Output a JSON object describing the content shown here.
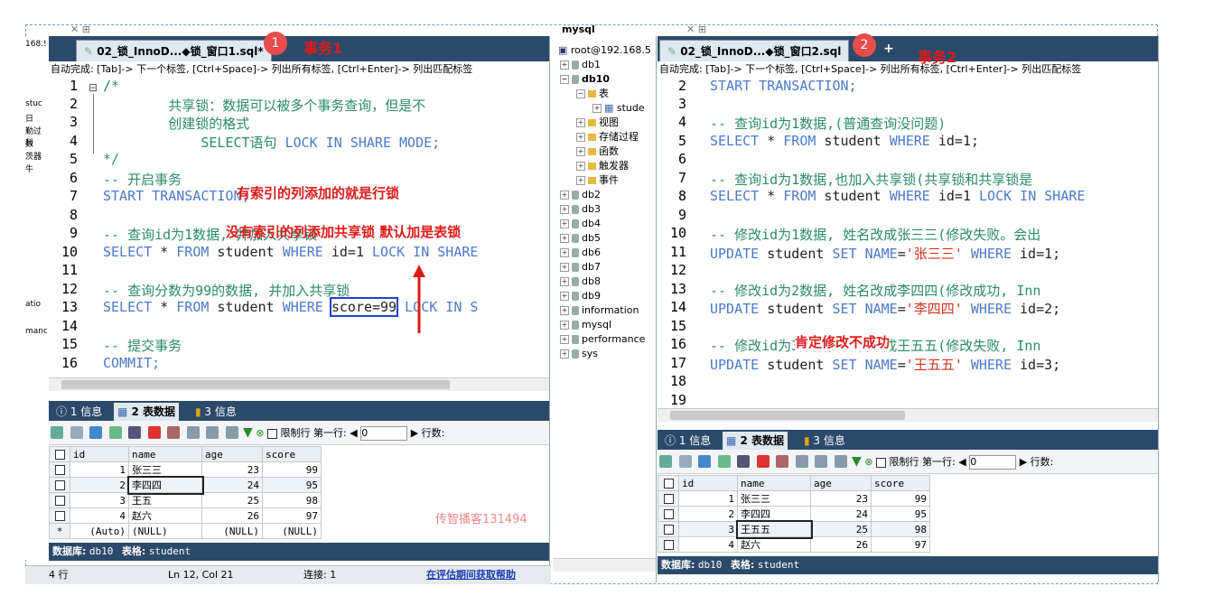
{
  "top_label": "mysql",
  "left_strip": [
    "168.!",
    "stuc",
    "日",
    "勤过科",
    "数",
    "茨器",
    "牛",
    "atio",
    "manc"
  ],
  "editor1": {
    "tab_title": "02_锁_InnoD...◆锁_窗口1.sql*",
    "badge": "1",
    "annotation_title": "事务1",
    "hint": "自动完成: [Tab]-> 下一个标签, [Ctrl+Space]-> 列出所有标签, [Ctrl+Enter]-> 列出匹配标签",
    "line_numbers": [
      "1",
      "2",
      "3",
      "4",
      "5",
      "6",
      "7",
      "8",
      "9",
      "10",
      "11",
      "12",
      "13",
      "14",
      "15",
      "16"
    ],
    "lines": {
      "l1": "/*",
      "l2": "        共享锁：数据可以被多个事务查询，但是不",
      "l3": "        创建锁的格式",
      "l4a": "            SELECT语句 ",
      "l4b": "LOCK IN SHARE MODE;",
      "l5": "*/",
      "l6": "-- 开启事务",
      "l7": "START TRANSACTION;",
      "l9": "-- 查询id为1数据, 并加入共享锁",
      "l10a": "SELECT",
      "l10b": " * ",
      "l10c": "FROM",
      "l10d": " student ",
      "l10e": "WHERE",
      "l10f": " id=1 ",
      "l10g": "LOCK IN SHARE",
      "l12": "-- 查询分数为99的数据, 并加入共享锁",
      "l13a": "SELECT",
      "l13b": " * ",
      "l13c": "FROM",
      "l13d": " student ",
      "l13e": "WHERE ",
      "l13f": "score=99",
      "l13g": " LOCK IN S",
      "l15": "-- 提交事务",
      "l16": "COMMIT;"
    },
    "annotations": {
      "row_lock": "有索引的列添加的就是行锁",
      "table_lock": "没有索引的列添加共享锁  默认加是表锁"
    }
  },
  "editor2": {
    "tab_title": "02_锁_InnoD...◆锁_窗口2.sql",
    "badge": "2",
    "annotation_title": "事务2",
    "hint": "自动完成: [Tab]-> 下一个标签, [Ctrl+Space]-> 列出所有标签, [Ctrl+Enter]-> 列出匹配标签",
    "line_numbers": [
      "2",
      "3",
      "4",
      "5",
      "6",
      "7",
      "8",
      "9",
      "10",
      "11",
      "12",
      "13",
      "14",
      "15",
      "16",
      "17",
      "18",
      "19"
    ],
    "lines": {
      "l2": "START TRANSACTION;",
      "l4": "-- 查询id为1数据,(普通查询没问题)",
      "l5a": "SELECT",
      "l5b": " * ",
      "l5c": "FROM",
      "l5d": " student ",
      "l5e": "WHERE",
      "l5f": " id=1;",
      "l7": "-- 查询id为1数据,也加入共享锁(共享锁和共享锁是",
      "l8a": "SELECT",
      "l8b": " * ",
      "l8c": "FROM",
      "l8d": " student ",
      "l8e": "WHERE",
      "l8f": " id=1 ",
      "l8g": "LOCK IN SHARE",
      "l10": "-- 修改id为1数据, 姓名改成张三三(修改失败。会出",
      "l11a": "UPDATE",
      "l11b": " student ",
      "l11c": "SET",
      "l11d": " ",
      "l11e": "NAME",
      "l11f": "=",
      "l11g": "'张三三'",
      "l11h": " ",
      "l11i": "WHERE",
      "l11j": " id=1;",
      "l13": "-- 修改id为2数据, 姓名改成李四四(修改成功, Inn",
      "l14a": "UPDATE",
      "l14b": " student ",
      "l14c": "SET",
      "l14d": " ",
      "l14e": "NAME",
      "l14f": "=",
      "l14g": "'李四四'",
      "l14h": " ",
      "l14i": "WHERE",
      "l14j": " id=2;",
      "l16": "-- 修改id为3数据, 姓名改成王五五(修改失败, Inn",
      "l17a": "UPDATE",
      "l17b": " student ",
      "l17c": "SET",
      "l17d": " ",
      "l17e": "NAME",
      "l17f": "=",
      "l17g": "'王五五'",
      "l17h": " ",
      "l17i": "WHERE",
      "l17j": " id=3;"
    },
    "annotations": {
      "fail": "肯定修改不成功"
    }
  },
  "tree": {
    "root": "root@192.168.5",
    "items": [
      "db1",
      "db10",
      "表",
      "stude",
      "视图",
      "存储过程",
      "函数",
      "触发器",
      "事件",
      "db2",
      "db3",
      "db4",
      "db5",
      "db6",
      "db7",
      "db8",
      "db9",
      "information",
      "mysql",
      "performance",
      "sys"
    ]
  },
  "result_tabs": [
    "1 信息",
    "2 表数据",
    "3 信息"
  ],
  "toolbar": {
    "limit": "限制行",
    "first_row": "第一行:",
    "first_row_value": "0",
    "rows": "行数:"
  },
  "table1": {
    "columns": [
      "id",
      "name",
      "age",
      "score"
    ],
    "rows": [
      [
        "1",
        "张三三",
        "23",
        "99"
      ],
      [
        "2",
        "李四四",
        "24",
        "95"
      ],
      [
        "3",
        "王五",
        "25",
        "98"
      ],
      [
        "4",
        "赵六",
        "26",
        "97"
      ],
      [
        "(Auto)",
        "(NULL)",
        "(NULL)",
        "(NULL)"
      ]
    ],
    "new_row_marker": "*"
  },
  "table2": {
    "columns": [
      "id",
      "name",
      "age",
      "score"
    ],
    "rows": [
      [
        "1",
        "张三三",
        "23",
        "99"
      ],
      [
        "2",
        "李四四",
        "24",
        "95"
      ],
      [
        "3",
        "王五五",
        "25",
        "98"
      ],
      [
        "4",
        "赵六",
        "26",
        "97"
      ]
    ]
  },
  "watermark": "传智播客131494",
  "status1": {
    "db_label": "数据库:",
    "db": "db10",
    "table_label": "表格:",
    "table": "student"
  },
  "status2": {
    "db_label": "数据库:",
    "db": "db10",
    "table_label": "表格:",
    "table": "student"
  },
  "bottom": {
    "rows": "4 行",
    "pos": "Ln 12, Col 21",
    "conn": "连接: 1",
    "help": "在评估期间获取帮助"
  },
  "colors": {
    "keyword": "#4b79c9",
    "comment": "#2a8a6a",
    "string": "#d2321e",
    "annotation": "#e01b1b"
  }
}
